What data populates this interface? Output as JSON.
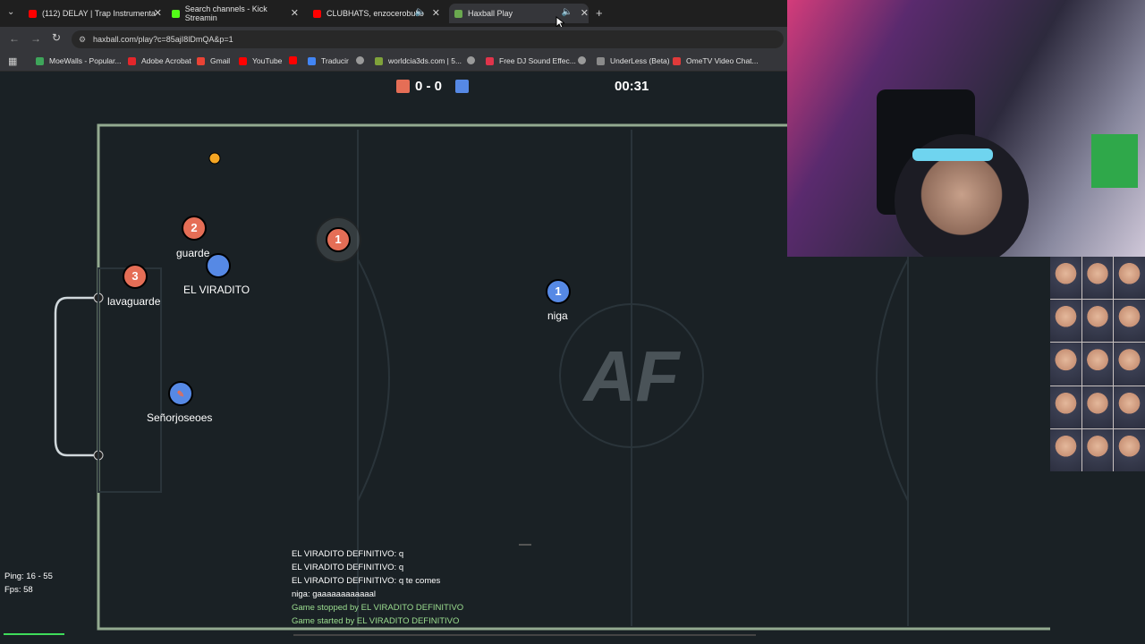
{
  "browser": {
    "tabs": [
      {
        "label": "(112) DELAY | Trap Instrumenta",
        "icon": "youtube-icon",
        "color": "#ff0000"
      },
      {
        "label": "Search channels - Kick Streamin",
        "icon": "kick-icon",
        "color": "#53fc18"
      },
      {
        "label": "CLUBHATS, enzocerobulto",
        "icon": "youtube-icon",
        "color": "#ff0000"
      },
      {
        "label": "Haxball Play",
        "icon": "haxball-icon",
        "color": "#6aa84f"
      }
    ],
    "url": "haxball.com/play?c=85ajI8lDmQA&p=1",
    "bookmarks": [
      {
        "label": "MoeWalls - Popular...",
        "color": "#3ea55a"
      },
      {
        "label": "Adobe Acrobat",
        "color": "#e3262b"
      },
      {
        "label": "Gmail",
        "color": "#ea4335"
      },
      {
        "label": "YouTube",
        "color": "#ff0000"
      },
      {
        "label": "",
        "color": "#ff0000"
      },
      {
        "label": "Traducir",
        "color": "#4285f4"
      },
      {
        "label": "",
        "color": "#9a9a9a"
      },
      {
        "label": "worldcia3ds.com | 5...",
        "color": "#7fa23a"
      },
      {
        "label": "",
        "color": "#9a9a9a"
      },
      {
        "label": "Free DJ Sound Effec...",
        "color": "#e0344b"
      },
      {
        "label": "",
        "color": "#9a9a9a"
      },
      {
        "label": "UnderLess (Beta)",
        "color": "#8a8a8a"
      },
      {
        "label": "OmeTV Video Chat...",
        "color": "#e03a3a"
      }
    ]
  },
  "game": {
    "score": "0 - 0",
    "timer": "00:31",
    "red_color": "#e56e56",
    "blue_color": "#5689e5",
    "logo": "AF",
    "players": [
      {
        "num": "2",
        "name": "guarde",
        "team": "red"
      },
      {
        "num": "3",
        "name": "lavaguarde",
        "team": "red"
      },
      {
        "num": "1",
        "name": "",
        "team": "red"
      },
      {
        "num": "",
        "name": "EL VIRADITO",
        "team": "blue"
      },
      {
        "num": "1",
        "name": "niga",
        "team": "blue"
      },
      {
        "num": "",
        "name": "Señorjoseoes",
        "team": "blue"
      }
    ],
    "chat": [
      {
        "text": "EL VIRADITO DEFINITIVO: q",
        "kind": "msg"
      },
      {
        "text": "EL VIRADITO DEFINITIVO: q",
        "kind": "msg"
      },
      {
        "text": "EL VIRADITO DEFINITIVO: q te comes",
        "kind": "msg"
      },
      {
        "text": "niga: gaaaaaaaaaaaal",
        "kind": "msg"
      },
      {
        "text": "Game stopped by EL VIRADITO DEFINITIVO",
        "kind": "notice"
      },
      {
        "text": "Game started by EL VIRADITO DEFINITIVO",
        "kind": "notice"
      }
    ],
    "ping": "Ping: 16 - 55",
    "fps": "Fps: 58"
  }
}
